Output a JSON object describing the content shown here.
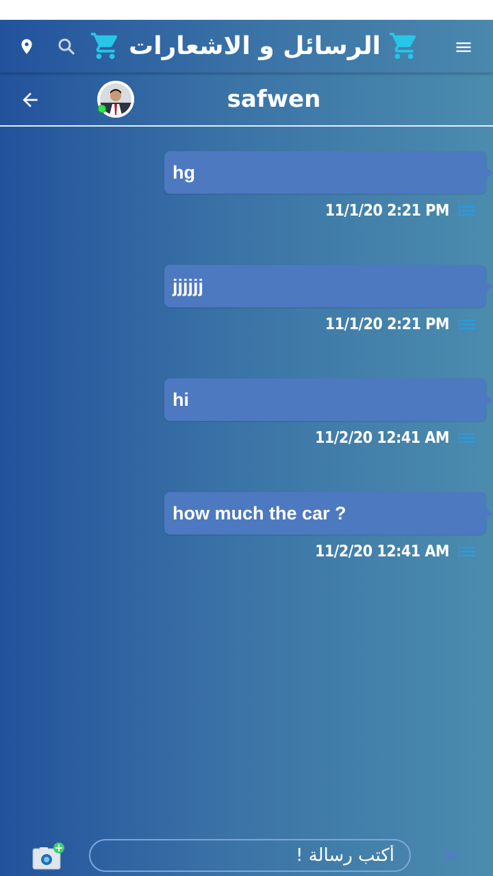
{
  "app_bar": {
    "title": "الرسائل و الاشعارات",
    "icons": [
      "location-pin-icon",
      "search-icon",
      "cart-icon",
      "menu-icon"
    ],
    "cart_color": "#27c5e6"
  },
  "chat_header": {
    "contact_name": "safwen",
    "status": "online",
    "status_color": "#2ee84a",
    "icons": [
      "back-arrow-icon",
      "avatar"
    ]
  },
  "messages": [
    {
      "text": "hg",
      "time": "11/1/20 2:21 PM"
    },
    {
      "text": "jjjjjj",
      "time": "11/1/20 2:21 PM"
    },
    {
      "text": "hi",
      "time": "11/2/20 12:41 AM"
    },
    {
      "text": "how much the car ?",
      "time": "11/2/20 12:41 AM"
    }
  ],
  "composer": {
    "placeholder": "أكتب رسالة !",
    "icons": [
      "camera-add-icon",
      "send-icon"
    ]
  },
  "colors": {
    "bubble": "#4d79c0",
    "accent": "#2a9be0",
    "background_start": "#23529c",
    "background_end": "#4b8cae"
  }
}
